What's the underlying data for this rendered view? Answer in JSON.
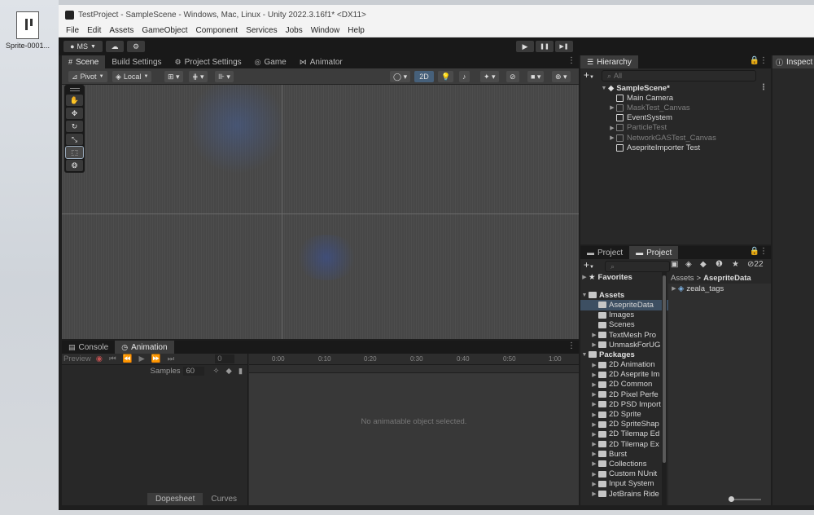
{
  "desktop": {
    "icon_label": "Sprite-0001..."
  },
  "window": {
    "title": "TestProject - SampleScene - Windows, Mac, Linux - Unity 2022.3.16f1* <DX11>"
  },
  "menu": [
    "File",
    "Edit",
    "Assets",
    "GameObject",
    "Component",
    "Services",
    "Jobs",
    "Window",
    "Help"
  ],
  "toolbar": {
    "account": "MS",
    "play_icon": "▶",
    "pause_icon": "❚❚",
    "step_icon": "▶❚"
  },
  "scene_tabs": {
    "scene": "Scene",
    "build_settings": "Build Settings",
    "project_settings": "Project Settings",
    "game": "Game",
    "animator": "Animator"
  },
  "scene_tools": {
    "pivot": "Pivot",
    "local": "Local",
    "mode_2d": "2D"
  },
  "hierarchy": {
    "tab": "Hierarchy",
    "search_placeholder": "All",
    "scene": "SampleScene*",
    "items": [
      {
        "label": "Main Camera",
        "dim": false,
        "expand": false
      },
      {
        "label": "MaskTest_Canvas",
        "dim": true,
        "expand": true
      },
      {
        "label": "EventSystem",
        "dim": false,
        "expand": false
      },
      {
        "label": "ParticleTest",
        "dim": true,
        "expand": true
      },
      {
        "label": "NetworkGASTest_Canvas",
        "dim": true,
        "expand": true
      },
      {
        "label": "AsepriteImporter Test",
        "dim": false,
        "expand": false
      }
    ]
  },
  "inspector": {
    "tab": "Inspect"
  },
  "project": {
    "tab_inactive": "Project",
    "tab_active": "Project",
    "hidden_count": "22",
    "favorites": "Favorites",
    "assets": "Assets",
    "asset_folders": [
      {
        "label": "AsepriteData",
        "selected": true,
        "expand": false
      },
      {
        "label": "Images",
        "selected": false,
        "expand": false
      },
      {
        "label": "Scenes",
        "selected": false,
        "expand": false
      },
      {
        "label": "TextMesh Pro",
        "selected": false,
        "expand": true
      },
      {
        "label": "UnmaskForUG",
        "selected": false,
        "expand": true
      }
    ],
    "packages": "Packages",
    "package_folders": [
      "2D Animation",
      "2D Aseprite Im",
      "2D Common",
      "2D Pixel Perfe",
      "2D PSD Import",
      "2D Sprite",
      "2D SpriteShap",
      "2D Tilemap Ed",
      "2D Tilemap Ex",
      "Burst",
      "Collections",
      "Custom NUnit",
      "Input System",
      "JetBrains Ride"
    ],
    "breadcrumb_root": "Assets",
    "breadcrumb_sep": ">",
    "breadcrumb_current": "AsepriteData",
    "content_item": "zeala_tags"
  },
  "console_tabs": {
    "console": "Console",
    "animation": "Animation"
  },
  "animation": {
    "preview": "Preview",
    "frame": "0",
    "samples_label": "Samples",
    "samples_value": "60",
    "ruler": [
      "0:00",
      "0:10",
      "0:20",
      "0:30",
      "0:40",
      "0:50",
      "1:00"
    ],
    "empty_message": "No animatable object selected.",
    "dopesheet": "Dopesheet",
    "curves": "Curves"
  },
  "colors": {
    "accent_blue": "#3d4f62",
    "panel_bg": "#282828",
    "viewport_bg": "#474747"
  }
}
